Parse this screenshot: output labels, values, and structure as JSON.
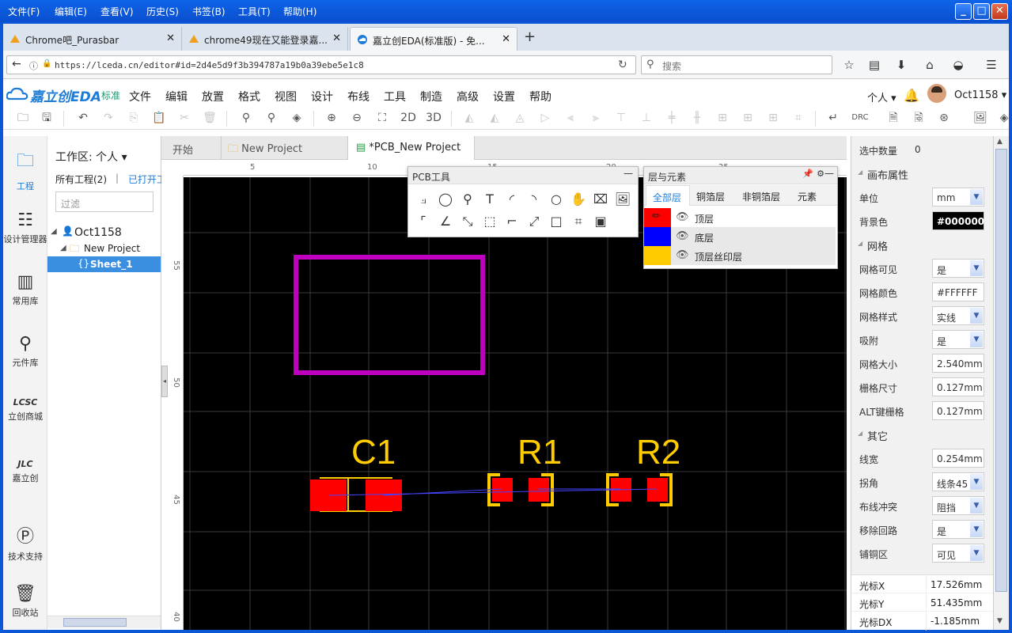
{
  "os_menu": {
    "items": [
      "文件(F)",
      "编辑(E)",
      "查看(V)",
      "历史(S)",
      "书签(B)",
      "工具(T)",
      "帮助(H)"
    ]
  },
  "browser_tabs": [
    {
      "title": "Chrome吧_Purasbar"
    },
    {
      "title": "chrome49现在又能登录嘉..."
    },
    {
      "title": "嘉立创EDA(标准版) - 免..."
    }
  ],
  "address_bar": {
    "url": "https://lceda.cn/editor#id=2d4e5d9f3b394787a19b0a39ebe5e1c8",
    "search_placeholder": "搜索"
  },
  "app": {
    "logo_text": "嘉立创EDA",
    "logo_badge": "标准",
    "menu": [
      "文件",
      "编辑",
      "放置",
      "格式",
      "视图",
      "设计",
      "布线",
      "工具",
      "制造",
      "高级",
      "设置",
      "帮助"
    ],
    "user_mode": "个人",
    "username": "Oct1158",
    "toolbar_labels": {
      "view2d": "2D",
      "view3d": "3D",
      "drc": "DRC"
    }
  },
  "left_nav": {
    "items": [
      "工程",
      "设计管理器",
      "常用库",
      "元件库",
      "立创商城",
      "嘉立创",
      "技术支持",
      "回收站"
    ]
  },
  "project_panel": {
    "workspace_label": "工作区: 个人",
    "all_projects": "所有工程(2)",
    "opened": "已打开工",
    "filter_placeholder": "过滤",
    "tree": {
      "user": "Oct1158",
      "project": "New Project",
      "sheet": "Sheet_1"
    }
  },
  "doc_tabs": [
    "开始",
    "New Project",
    "*PCB_New Project"
  ],
  "rulers": {
    "top": [
      "5",
      "10",
      "15",
      "20",
      "25"
    ],
    "left": [
      "55",
      "50",
      "45",
      "40"
    ]
  },
  "pcb_tools": {
    "title": "PCB工具"
  },
  "layers": {
    "title": "层与元素",
    "tabs": [
      "全部层",
      "铜箔层",
      "非铜箔层",
      "元素"
    ],
    "rows": [
      {
        "name": "顶层",
        "color": "#ff0000"
      },
      {
        "name": "底层",
        "color": "#0000ff"
      },
      {
        "name": "顶层丝印层",
        "color": "#ffcc00"
      }
    ]
  },
  "canvas": {
    "components": [
      "C1",
      "R1",
      "R2"
    ],
    "colors": {
      "background": "#000000",
      "outline": "#c000c0",
      "silk": "#ffcc00",
      "pad": "#ff0000",
      "track": "#3333ff"
    }
  },
  "properties": {
    "selected_count_label": "选中数量",
    "selected_count": "0",
    "canvas_section": "画布属性",
    "unit_label": "单位",
    "unit": "mm",
    "bg_label": "背景色",
    "bg": "#000000",
    "grid_section": "网格",
    "grid_visible_label": "网格可见",
    "grid_visible": "是",
    "grid_color_label": "网格颜色",
    "grid_color": "#FFFFFF",
    "grid_style_label": "网格样式",
    "grid_style": "实线",
    "snap_label": "吸附",
    "snap": "是",
    "grid_size_label": "网格大小",
    "grid_size": "2.540mm",
    "grid_step_label": "栅格尺寸",
    "grid_step": "0.127mm",
    "alt_grid_label": "ALT键栅格",
    "alt_grid": "0.127mm",
    "other_section": "其它",
    "line_width_label": "线宽",
    "line_width": "0.254mm",
    "corner_label": "拐角",
    "corner": "线条45",
    "conflict_label": "布线冲突",
    "conflict": "阻挡",
    "remove_loop_label": "移除回路",
    "remove_loop": "是",
    "copper_label": "铺铜区",
    "copper": "可见",
    "cursor_x_label": "光标X",
    "cursor_x": "17.526mm",
    "cursor_y_label": "光标Y",
    "cursor_y": "51.435mm",
    "cursor_dx_label": "光标DX",
    "cursor_dx": "-1.185mm"
  }
}
